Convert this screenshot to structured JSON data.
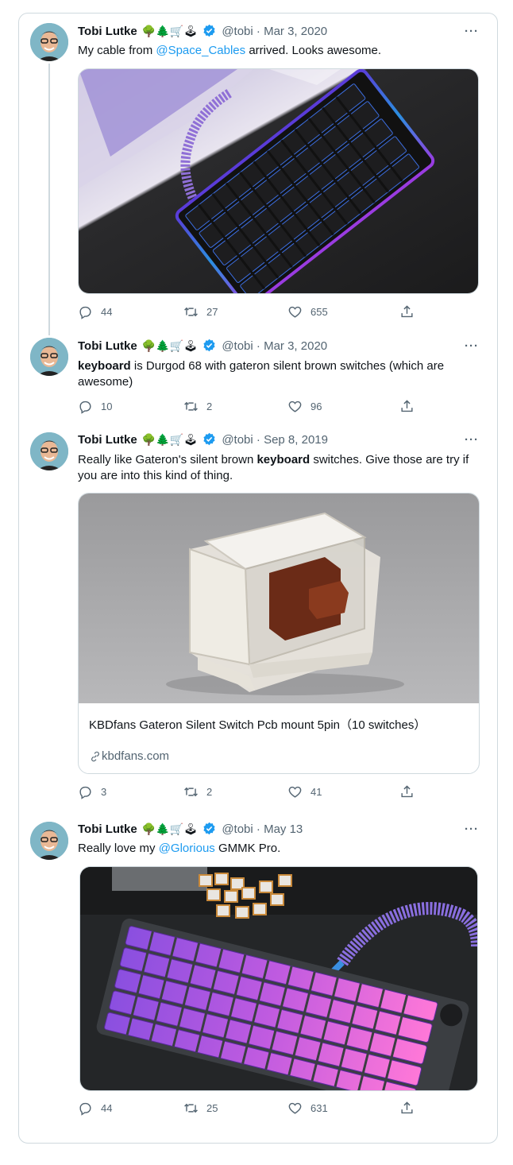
{
  "author": {
    "name": "Tobi Lutke",
    "emoji": "🌳🌲🛒🕹",
    "handle": "@tobi",
    "separator": "·"
  },
  "tweets": [
    {
      "date": "Mar 3, 2020",
      "text_before": "My cable from ",
      "mention": "@Space_Cables",
      "text_after": " arrived. Looks awesome.",
      "image": "keyboard-black-rgb",
      "replies": "44",
      "retweets": "27",
      "likes": "655"
    },
    {
      "date": "Mar 3, 2020",
      "bold": "keyboard",
      "text_after": " is Durgod 68 with gateron silent brown switches (which are awesome)",
      "replies": "10",
      "retweets": "2",
      "likes": "96"
    },
    {
      "date": "Sep 8, 2019",
      "text_before": "Really like Gateron's silent brown ",
      "bold": "keyboard",
      "text_after": " switches. Give those are try if you are into this kind of thing.",
      "link_card": {
        "title": "KBDfans Gateron Silent Switch Pcb mount 5pin（10 switches）",
        "domain": "kbdfans.com"
      },
      "replies": "3",
      "retweets": "2",
      "likes": "41"
    },
    {
      "date": "May 13",
      "text_before": "Really love my ",
      "mention": "@Glorious",
      "text_after": " GMMK Pro.",
      "image": "keyboard-purple-pink",
      "replies": "44",
      "retweets": "25",
      "likes": "631"
    }
  ],
  "colors": {
    "accent": "#1d9bf0",
    "secondary_text": "#536471",
    "border": "#cfd9de"
  },
  "icons": [
    "reply-icon",
    "retweet-icon",
    "like-icon",
    "share-icon",
    "verified-icon",
    "more-icon",
    "link-icon"
  ]
}
